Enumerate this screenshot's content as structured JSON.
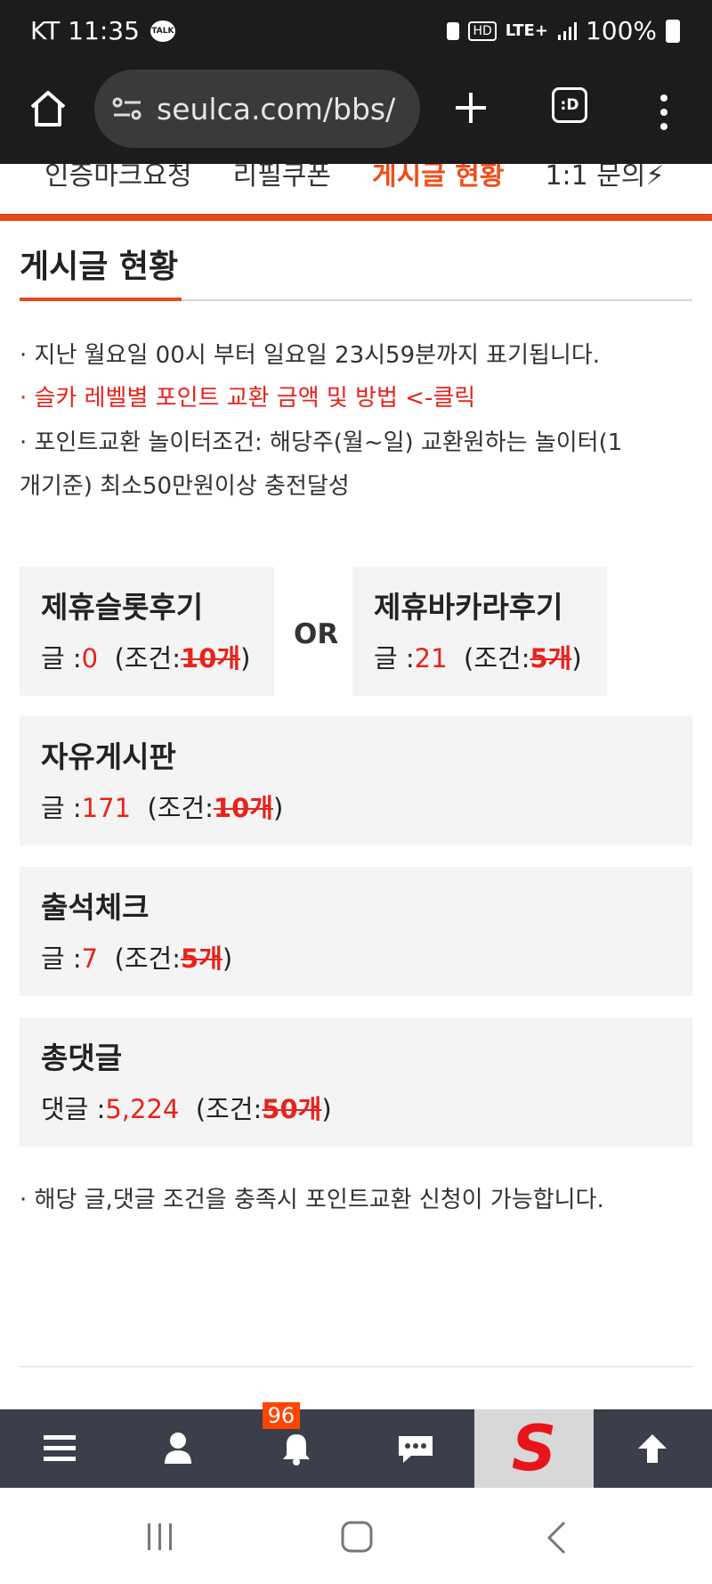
{
  "status_bar": {
    "carrier_time": "KT 11:35",
    "talk": "TALK",
    "hd": "HD",
    "network": "LTE+",
    "battery": "100%"
  },
  "browser": {
    "url": "seulca.com/bbs/",
    "tabs_label": ":D"
  },
  "page_nav": {
    "items": [
      {
        "label": "인증마크요청"
      },
      {
        "label": "리필쿠폰"
      },
      {
        "label": "게시글 현황"
      },
      {
        "label": "1:1 문의"
      }
    ],
    "active_index": 2
  },
  "page_title": "게시글 현황",
  "notices": {
    "line1": "· 지난 월요일 00시 부터 일요일 23시59분까지 표기됩니다.",
    "line2": "· 슬카 레벨별 포인트 교환 금액 및 방법 <-클릭",
    "line3a": "· 포인트교환 놀이터조건: 해당주(월~일) 교환원하는 놀이터(1",
    "line3b": "개기준) 최소50만원이상 충전달성",
    "footer": "· 해당 글,댓글 조건을 충족시 포인트교환 신청이 가능합니다."
  },
  "or_label": "OR",
  "condition_open": "(조건:",
  "condition_close": ")",
  "boards": {
    "slot": {
      "title": "제휴슬롯후기",
      "prefix": "글 :",
      "count": "0",
      "requirement": "10개"
    },
    "baccarat": {
      "title": "제휴바카라후기",
      "prefix": "글 :",
      "count": "21",
      "requirement": "5개"
    },
    "free": {
      "title": "자유게시판",
      "prefix": "글 :",
      "count": "171",
      "requirement": "10개"
    },
    "attendance": {
      "title": "출석체크",
      "prefix": "글 :",
      "count": "7",
      "requirement": "5개"
    },
    "comments": {
      "title": "총댓글",
      "prefix": "댓글 :",
      "count": "5,224",
      "requirement": "50개"
    }
  },
  "bottom_bar": {
    "notification_count": "96",
    "logo_letter": "S"
  },
  "colors": {
    "accent": "#e8471a",
    "red_text": "#e8231c",
    "toolbar": "#3b3f4a"
  }
}
